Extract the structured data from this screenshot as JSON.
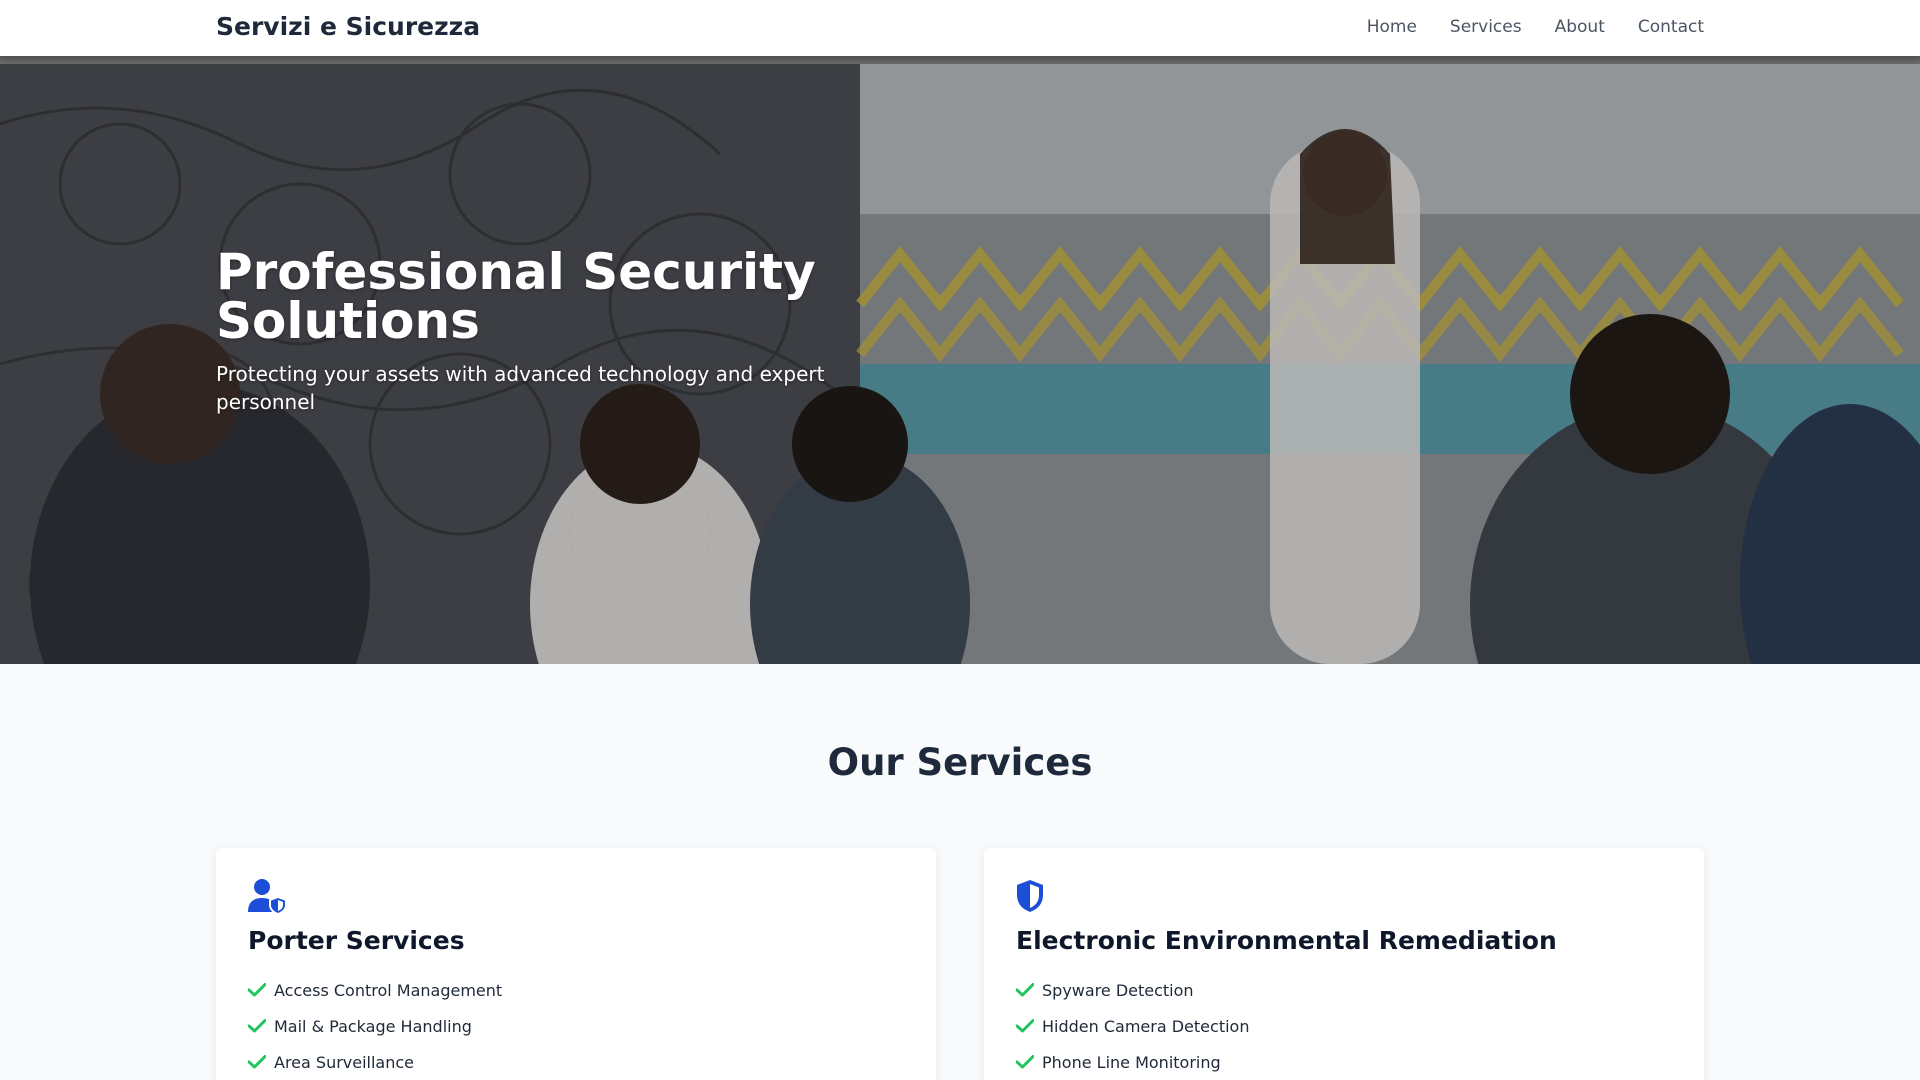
{
  "header": {
    "brand": "Servizi e Sicurezza",
    "nav": [
      "Home",
      "Services",
      "About",
      "Contact"
    ]
  },
  "hero": {
    "title": "Professional Security Solutions",
    "subtitle": "Protecting your assets with advanced technology and expert personnel",
    "image": "office-meeting-photo"
  },
  "services": {
    "heading": "Our Services",
    "cards": [
      {
        "title": "Porter Services",
        "icon": "user-shield-icon",
        "items": [
          "Access Control Management",
          "Mail & Package Handling",
          "Area Surveillance"
        ]
      },
      {
        "title": "Electronic Environmental Remediation",
        "icon": "shield-icon",
        "items": [
          "Spyware Detection",
          "Hidden Camera Detection",
          "Phone Line Monitoring"
        ]
      }
    ]
  },
  "colors": {
    "accent": "#1d4ed8",
    "check": "#22c55e",
    "text": "#1e293b"
  }
}
